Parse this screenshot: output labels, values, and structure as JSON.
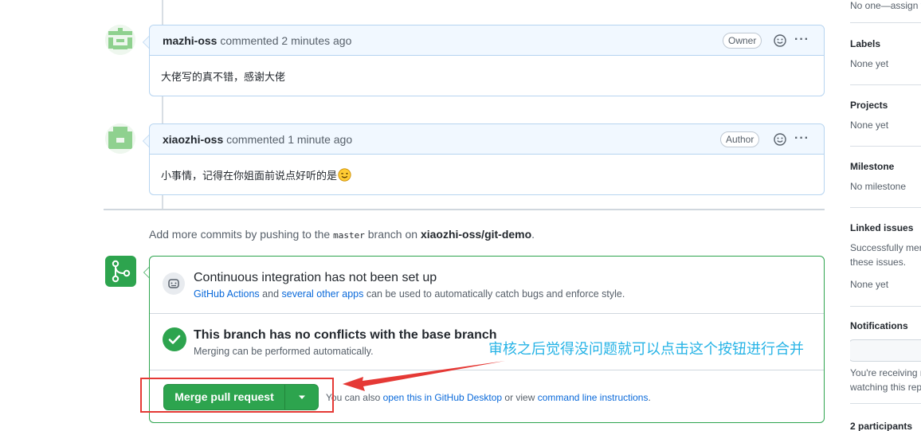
{
  "comments": [
    {
      "author": "mazhi-oss",
      "action": "commented",
      "time": "2 minutes ago",
      "role": "Owner",
      "body": "大佬写的真不错，感谢大佬"
    },
    {
      "author": "xiaozhi-oss",
      "action": "commented",
      "time": "1 minute ago",
      "role": "Author",
      "body": "小事情，记得在你姐面前说点好听的是"
    }
  ],
  "push_note": {
    "prefix": "Add more commits by pushing to the",
    "branch": "master",
    "middle": "branch on",
    "repo": "xiaozhi-oss/git-demo",
    "suffix": "."
  },
  "ci": {
    "title": "Continuous integration has not been set up",
    "link1": "GitHub Actions",
    "and": "and",
    "link2": "several other apps",
    "rest": "can be used to automatically catch bugs and enforce style."
  },
  "conflicts": {
    "title": "This branch has no conflicts with the base branch",
    "sub": "Merging can be performed automatically."
  },
  "merge": {
    "button_label": "Merge pull request",
    "alt_prefix": "You can also",
    "alt_link1": "open this in GitHub Desktop",
    "alt_middle": "or view",
    "alt_link2": "command line instructions",
    "alt_suffix": "."
  },
  "annotation": "审核之后觉得没问题就可以点击这个按钮进行合并",
  "sidebar": {
    "assignees_text": "No one—assign y",
    "labels_title": "Labels",
    "labels_value": "None yet",
    "projects_title": "Projects",
    "projects_value": "None yet",
    "milestone_title": "Milestone",
    "milestone_value": "No milestone",
    "linked_title": "Linked issues",
    "linked_text1": "Successfully merg",
    "linked_text2": "these issues.",
    "linked_value": "None yet",
    "notifications_title": "Notifications",
    "notifications_text1": "You're receiving n",
    "notifications_text2": "watching this rep",
    "participants_title": "2 participants"
  },
  "colors": {
    "accent_green": "#2da44e",
    "link_blue": "#0969da",
    "annotation_cyan": "#26b3e6",
    "highlight_red": "#e53935"
  }
}
